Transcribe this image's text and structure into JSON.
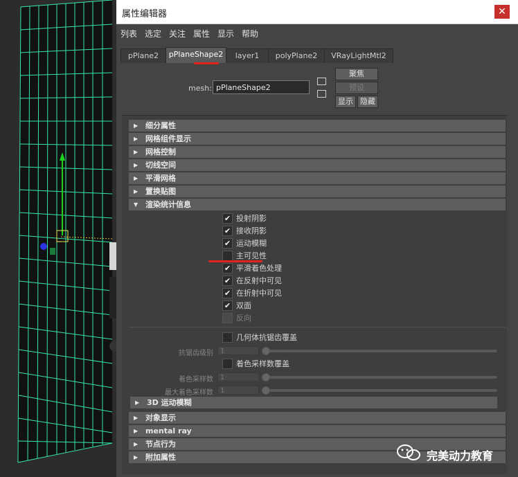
{
  "window": {
    "title": "属性编辑器"
  },
  "menu": [
    "列表",
    "选定",
    "关注",
    "属性",
    "显示",
    "帮助"
  ],
  "tabs": [
    "pPlane2",
    "pPlaneShape2",
    "layer1",
    "polyPlane2",
    "VRayLightMtl2"
  ],
  "active_tab_index": 1,
  "mesh": {
    "label": "mesh:",
    "value": "pPlaneShape2"
  },
  "buttons": {
    "focus": "聚焦",
    "preset": "预设",
    "show": "显示",
    "hide": "隐藏"
  },
  "sections_top": [
    "细分属性",
    "网格组件显示",
    "网格控制",
    "切线空间",
    "平滑网格",
    "置换贴图"
  ],
  "render_stats": {
    "title": "渲染统计信息",
    "checkboxes": [
      {
        "label": "投射阴影",
        "checked": true,
        "disabled": false
      },
      {
        "label": "接收阴影",
        "checked": true,
        "disabled": false
      },
      {
        "label": "运动模糊",
        "checked": true,
        "disabled": false
      },
      {
        "label": "主可见性",
        "checked": false,
        "disabled": false
      },
      {
        "label": "平滑着色处理",
        "checked": true,
        "disabled": false
      },
      {
        "label": "在反射中可见",
        "checked": true,
        "disabled": false
      },
      {
        "label": "在折射中可见",
        "checked": true,
        "disabled": false
      },
      {
        "label": "双面",
        "checked": true,
        "disabled": false
      },
      {
        "label": "反向",
        "checked": false,
        "disabled": true
      }
    ],
    "geometry_aa_override": "几何体抗锯齿覆盖",
    "aa_level": {
      "label": "抗锯齿级别",
      "value": "1"
    },
    "shading_samples_override": "着色采样数覆盖",
    "shading_samples": {
      "label": "着色采样数",
      "value": "1"
    },
    "max_shading_samples": {
      "label": "最大着色采样数",
      "value": "1"
    },
    "motion_blur_3d": "3D 运动模糊"
  },
  "sections_bottom": [
    "对象显示",
    "mental ray",
    "节点行为",
    "附加属性"
  ],
  "watermark": "完美动力教育",
  "colors": {
    "accent_red": "#e4221c",
    "grid_green": "#39e8a6",
    "panel_bg": "#444444"
  }
}
